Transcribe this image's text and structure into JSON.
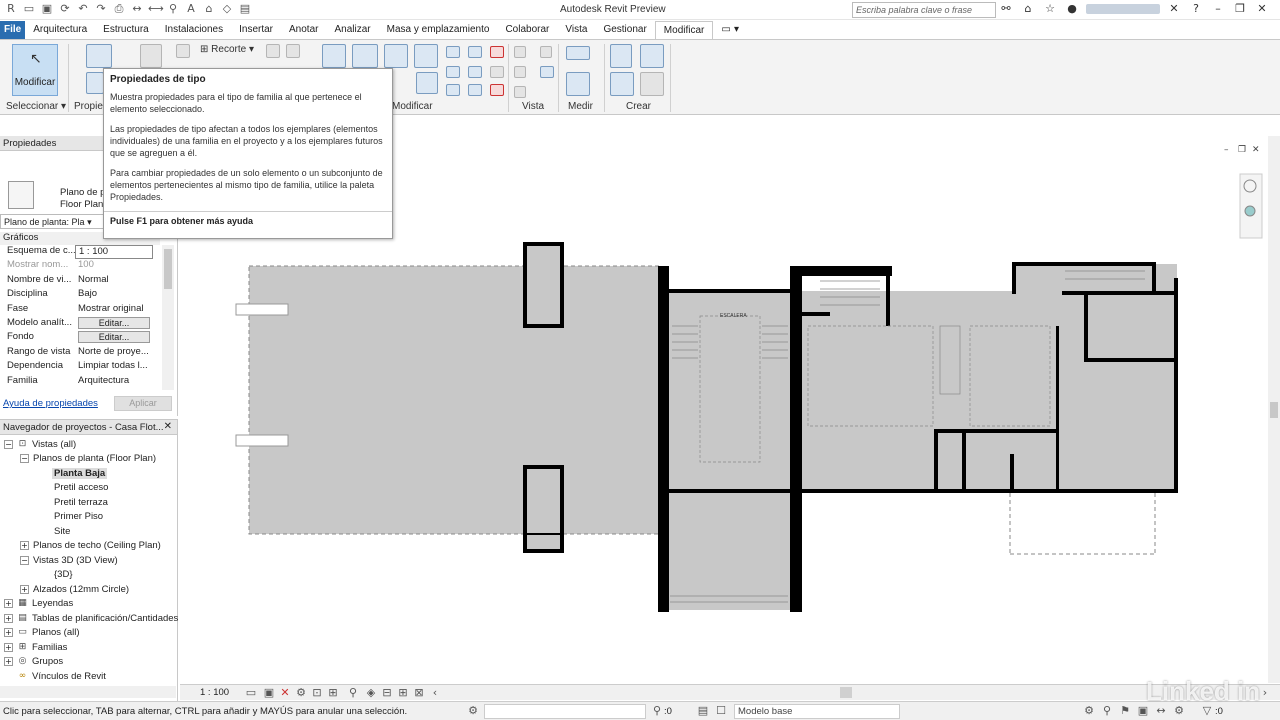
{
  "titlebar": {
    "app_title": "Autodesk Revit Preview",
    "search_placeholder": "Escriba palabra clave o frase",
    "icons": [
      "revit-logo-icon",
      "open-icon",
      "save-icon",
      "sync-icon",
      "undo-icon",
      "redo-icon",
      "print-icon",
      "measure-icon",
      "dimension-icon",
      "tag-icon",
      "text-icon",
      "3d-view-icon",
      "section-icon",
      "close-hidden-icon"
    ]
  },
  "tabs": [
    {
      "label": "File"
    },
    {
      "label": "Arquitectura"
    },
    {
      "label": "Estructura"
    },
    {
      "label": "Instalaciones"
    },
    {
      "label": "Insertar"
    },
    {
      "label": "Anotar"
    },
    {
      "label": "Analizar"
    },
    {
      "label": "Masa y emplazamiento"
    },
    {
      "label": "Colaborar"
    },
    {
      "label": "Vista"
    },
    {
      "label": "Gestionar"
    },
    {
      "label": "Modificar"
    }
  ],
  "ribbon": {
    "modify_button": "Modificar",
    "select_panel": "Seleccionar",
    "properties_panel": "Propie",
    "recorte_label": "Recorte",
    "modify_panel": "Modificar",
    "view_panel": "Vista",
    "measure_panel": "Medir",
    "create_panel": "Crear"
  },
  "tooltip": {
    "title": "Propiedades de tipo",
    "p1": "Muestra propiedades para el tipo de familia al que pertenece el elemento seleccionado.",
    "p2": "Las propiedades de tipo afectan a todos los ejemplares (elementos individuales) de una familia en el proyecto y a los ejemplares futuros que se agreguen a él.",
    "p3": "Para cambiar propiedades de un solo elemento o un subconjunto de elementos pertenecientes al mismo tipo de familia, utilice la paleta Propiedades.",
    "help": "Pulse F1 para obtener más ayuda"
  },
  "properties": {
    "header": "Propiedades",
    "type_line1": "Plano de p",
    "type_line2": "Floor Plan",
    "selector": "Plano de planta: Pla",
    "group": "Gráficos",
    "rows": [
      {
        "k": "Esquema de c...",
        "v": "1 : 100"
      },
      {
        "k": "Mostrar nom...",
        "v": "100"
      },
      {
        "k": "Nombre de vi...",
        "v": "Normal"
      },
      {
        "k": "Disciplina",
        "v": "Bajo"
      },
      {
        "k": "Fase",
        "v": "Mostrar original"
      },
      {
        "k": "Modelo analít...",
        "v": "Editar..."
      },
      {
        "k": "Fondo",
        "v": "Editar..."
      },
      {
        "k": "Rango de vista",
        "v": "Norte de proye..."
      },
      {
        "k": "Dependencia",
        "v": "Limpiar todas l..."
      },
      {
        "k": "Familia",
        "v": "Arquitectura"
      }
    ],
    "help_link": "Ayuda de propiedades",
    "apply_button": "Aplicar"
  },
  "browser": {
    "header": "Navegador de proyectos - Casa Flot...",
    "items": [
      {
        "label": "Vistas (all)",
        "toggle": "−",
        "icon": "views-icon"
      },
      {
        "label": "Planos de planta (Floor Plan)",
        "toggle": "−"
      },
      {
        "label": "Planta Baja"
      },
      {
        "label": "Pretil acceso"
      },
      {
        "label": "Pretil terraza"
      },
      {
        "label": "Primer Piso"
      },
      {
        "label": "Site"
      },
      {
        "label": "Planos de techo (Ceiling Plan)",
        "toggle": "+"
      },
      {
        "label": "Vistas 3D (3D View)",
        "toggle": "−"
      },
      {
        "label": "{3D}"
      },
      {
        "label": "Alzados (12mm Circle)",
        "toggle": "+"
      },
      {
        "label": "Leyendas",
        "toggle": "+",
        "icon": "legend-icon"
      },
      {
        "label": "Tablas de planificación/Cantidades",
        "toggle": "+",
        "icon": "schedule-icon"
      },
      {
        "label": "Planos (all)",
        "toggle": "+",
        "icon": "sheet-icon"
      },
      {
        "label": "Familias",
        "toggle": "+",
        "icon": "family-icon"
      },
      {
        "label": "Grupos",
        "toggle": "+",
        "icon": "group-icon"
      },
      {
        "label": "Vínculos de Revit",
        "icon": "link-icon"
      }
    ]
  },
  "canvas": {
    "room_label": "ESCALERA"
  },
  "viewbar": {
    "scale": "1 : 100"
  },
  "status": {
    "text": "Clic para seleccionar, TAB para alternar, CTRL para añadir y MAYÚS para anular una selección.",
    "count": ":0",
    "model": "Modelo base",
    "filter": ":0"
  },
  "watermark": "Linked in",
  "colors": {
    "file_tab": "#2a6db0",
    "selection_blue": "#c8dff3",
    "hatch_gray": "#c8c8c8",
    "wall": "#000000"
  }
}
